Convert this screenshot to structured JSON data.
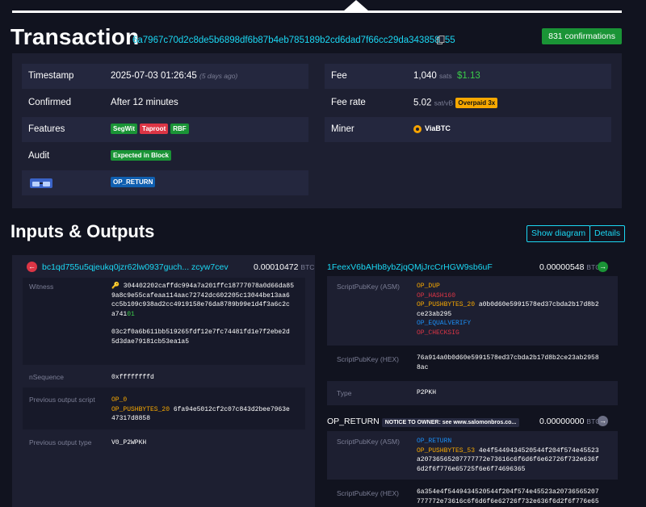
{
  "header": {
    "title": "Transaction",
    "txid": "6a7967c70d2c8de5b6898df6b87b4eb785189b2cd6dad7f66cc29da343858e55",
    "confirmations": "831 confirmations"
  },
  "details": {
    "timestamp_label": "Timestamp",
    "timestamp_value": "2025-07-03 01:26:45",
    "timestamp_ago": "(5 days ago)",
    "confirmed_label": "Confirmed",
    "confirmed_value": "After 12 minutes",
    "features_label": "Features",
    "features": [
      "SegWit",
      "Taproot",
      "RBF"
    ],
    "audit_label": "Audit",
    "audit_value": "Expected in Block",
    "op_return_tag": "OP_RETURN",
    "fee_label": "Fee",
    "fee_value": "1,040",
    "fee_unit": "sats",
    "fee_usd": "$1.13",
    "feerate_label": "Fee rate",
    "feerate_value": "5.02",
    "feerate_unit": "sat/vB",
    "overpaid": "Overpaid 3x",
    "miner_label": "Miner",
    "miner_value": "ViaBTC"
  },
  "io": {
    "section_title": "Inputs & Outputs",
    "show_diagram": "Show diagram",
    "details_btn": "Details",
    "input": {
      "address": "bc1qd755u5qjeukq0jzr62lw0937guch... zcyw7cev",
      "amount": "0.00010472",
      "unit": "BTC",
      "witness_label": "Witness",
      "witness_line1": "304402202caffdc994a7a201ffc18777078a0d66da85",
      "witness_line2": "9a8c9e55cafeaa114aac72742dc602205c13044be13aa6",
      "witness_line3": "cc5b109c938ad2cc4919158e76da8789b99e1d4f3a6c2c",
      "witness_line4a": "a741",
      "witness_line4b": "01",
      "witness_line5": "03c2f0a6b611bb519265fdf12e7fc74481fd1e7f2ebe2d",
      "witness_line6": "5d3dae79181cb53ea1a5",
      "nsequence_label": "nSequence",
      "nsequence_value": "0xffffffffd",
      "prevscript_label": "Previous output script",
      "prevscript_op0": "OP_0",
      "prevscript_push": "OP_PUSHBYTES_20",
      "prevscript_data1": "6fa94e5012cf2c07c843d2bee7963e",
      "prevscript_data2": "47317d8858",
      "prevtype_label": "Previous output type",
      "prevtype_value": "V0_P2WPKH"
    },
    "output1": {
      "address": "1FeexV6bAHb8ybZjqQMjJrcCrHGW9sb6uF",
      "amount": "0.00000548",
      "unit": "BTC",
      "asm_label": "ScriptPubKey (ASM)",
      "asm_dup": "OP_DUP",
      "asm_hash160": "OP_HASH160",
      "asm_push": "OP_PUSHBYTES_20",
      "asm_data1": "a0b0d60e5991578ed37cbda2b17d8b2",
      "asm_data2": "ce23ab295",
      "asm_equalverify": "OP_EQUALVERIFY",
      "asm_checksig": "OP_CHECKSIG",
      "hex_label": "ScriptPubKey (HEX)",
      "hex_line1": "76a914a0b0d60e5991578ed37cbda2b17d8b2ce23ab2958",
      "hex_line2": "8ac",
      "type_label": "Type",
      "type_value": "P2PKH"
    },
    "output2": {
      "label": "OP_RETURN",
      "notice": "NOTICE TO OWNER: see www.salomonbros.co...",
      "amount": "0.00000000",
      "unit": "BTC",
      "asm_label": "ScriptPubKey (ASM)",
      "asm_return": "OP_RETURN",
      "asm_push": "OP_PUSHBYTES_53",
      "asm_data1": "4e4f5449434520544f204f574e45523",
      "asm_data2": "a20736565207777772e73616c6f6d6f6e62726f732e636f",
      "asm_data3": "6d2f6f776e65725f6e6f74696365",
      "hex_label": "ScriptPubKey (HEX)",
      "hex_line1": "6a354e4f5449434520544f204f574e45523a20736565207",
      "hex_line2": "777772e73616c6f6d6f6e62726f732e636f6d2f6f776e65"
    }
  }
}
